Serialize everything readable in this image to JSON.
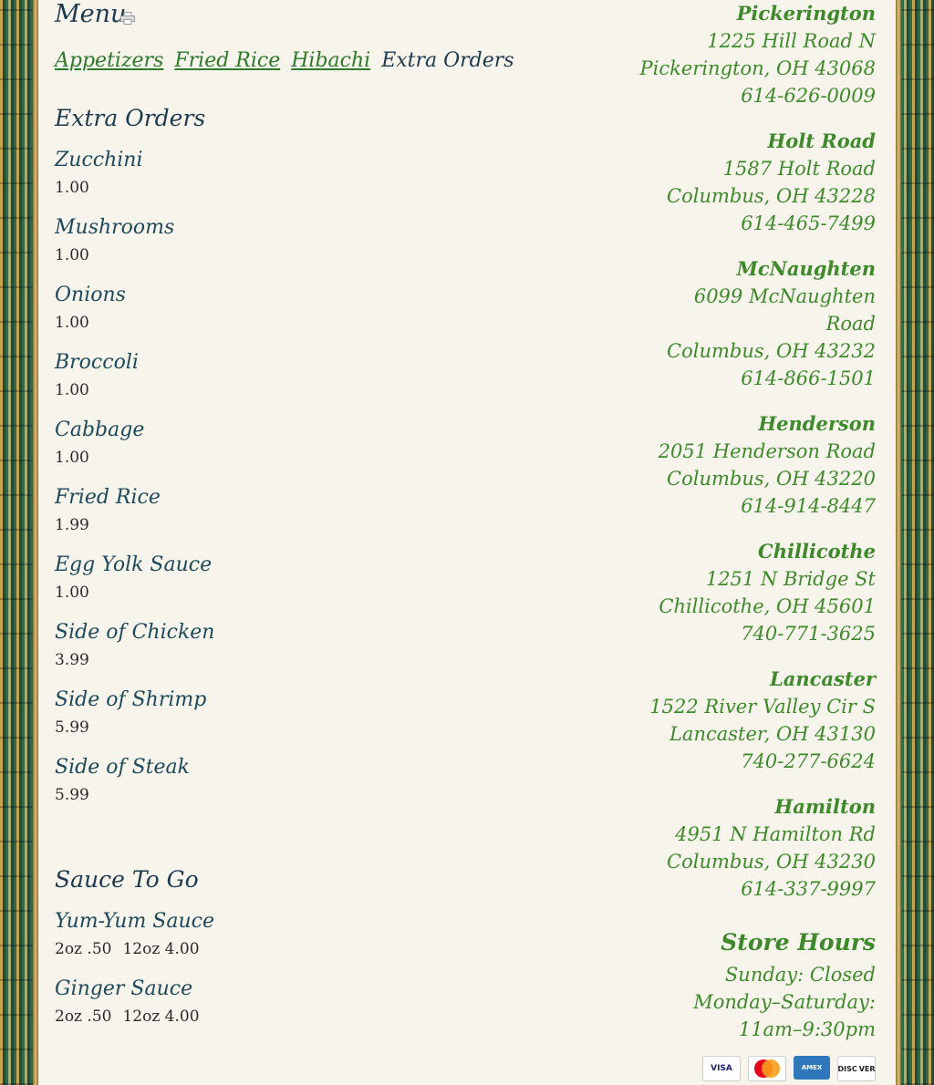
{
  "menu": {
    "title": "Menu",
    "tabs": [
      {
        "label": "Appetizers",
        "active": false
      },
      {
        "label": "Fried Rice",
        "active": false
      },
      {
        "label": "Hibachi",
        "active": false
      },
      {
        "label": "Extra Orders",
        "active": true
      }
    ],
    "sections": [
      {
        "title": "Extra Orders",
        "items": [
          {
            "name": "Zucchini",
            "prices": [
              "1.00"
            ]
          },
          {
            "name": "Mushrooms",
            "prices": [
              "1.00"
            ]
          },
          {
            "name": "Onions",
            "prices": [
              "1.00"
            ]
          },
          {
            "name": "Broccoli",
            "prices": [
              "1.00"
            ]
          },
          {
            "name": "Cabbage",
            "prices": [
              "1.00"
            ]
          },
          {
            "name": "Fried Rice",
            "prices": [
              "1.99"
            ]
          },
          {
            "name": "Egg Yolk Sauce",
            "prices": [
              "1.00"
            ]
          },
          {
            "name": "Side of Chicken",
            "prices": [
              "3.99"
            ]
          },
          {
            "name": "Side of Shrimp",
            "prices": [
              "5.99"
            ]
          },
          {
            "name": "Side of Steak",
            "prices": [
              "5.99"
            ]
          }
        ]
      },
      {
        "title": "Sauce To Go",
        "items": [
          {
            "name": "Yum-Yum Sauce",
            "prices": [
              "2oz .50",
              "12oz 4.00"
            ]
          },
          {
            "name": "Ginger Sauce",
            "prices": [
              "2oz .50",
              "12oz 4.00"
            ]
          }
        ]
      }
    ]
  },
  "sidebar": {
    "locations": [
      {
        "name": "Pickerington",
        "lines": [
          "1225 Hill Road N",
          "Pickerington, OH 43068",
          "614-626-0009"
        ]
      },
      {
        "name": "Holt Road",
        "lines": [
          "1587 Holt Road",
          "Columbus, OH 43228",
          "614-465-7499"
        ]
      },
      {
        "name": "McNaughten",
        "lines": [
          "6099 McNaughten",
          "Road",
          "Columbus, OH 43232",
          "614-866-1501"
        ]
      },
      {
        "name": "Henderson",
        "lines": [
          "2051 Henderson Road",
          "Columbus, OH 43220",
          "614-914-8447"
        ]
      },
      {
        "name": "Chillicothe",
        "lines": [
          "1251 N Bridge St",
          "Chillicothe, OH 45601",
          "740-771-3625"
        ]
      },
      {
        "name": "Lancaster",
        "lines": [
          "1522 River Valley Cir S",
          "Lancaster, OH 43130",
          "740-277-6624"
        ]
      },
      {
        "name": "Hamilton",
        "lines": [
          "4951 N Hamilton Rd",
          "Columbus, OH 43230",
          "614-337-9997"
        ]
      }
    ],
    "hours": {
      "title": "Store Hours",
      "lines": [
        "Sunday: Closed",
        "Monday–Saturday:",
        "11am–9:30pm"
      ]
    },
    "payment_cards": [
      "VISA",
      "MasterCard",
      "AMERICAN EXPRESS",
      "DISCOVER"
    ]
  },
  "icons": {
    "print": "printer-icon"
  },
  "colors": {
    "heading": "#1d3a4f",
    "link": "#2c7a2a",
    "location_text": "#3d8a2a",
    "price": "#2a2a2a"
  }
}
